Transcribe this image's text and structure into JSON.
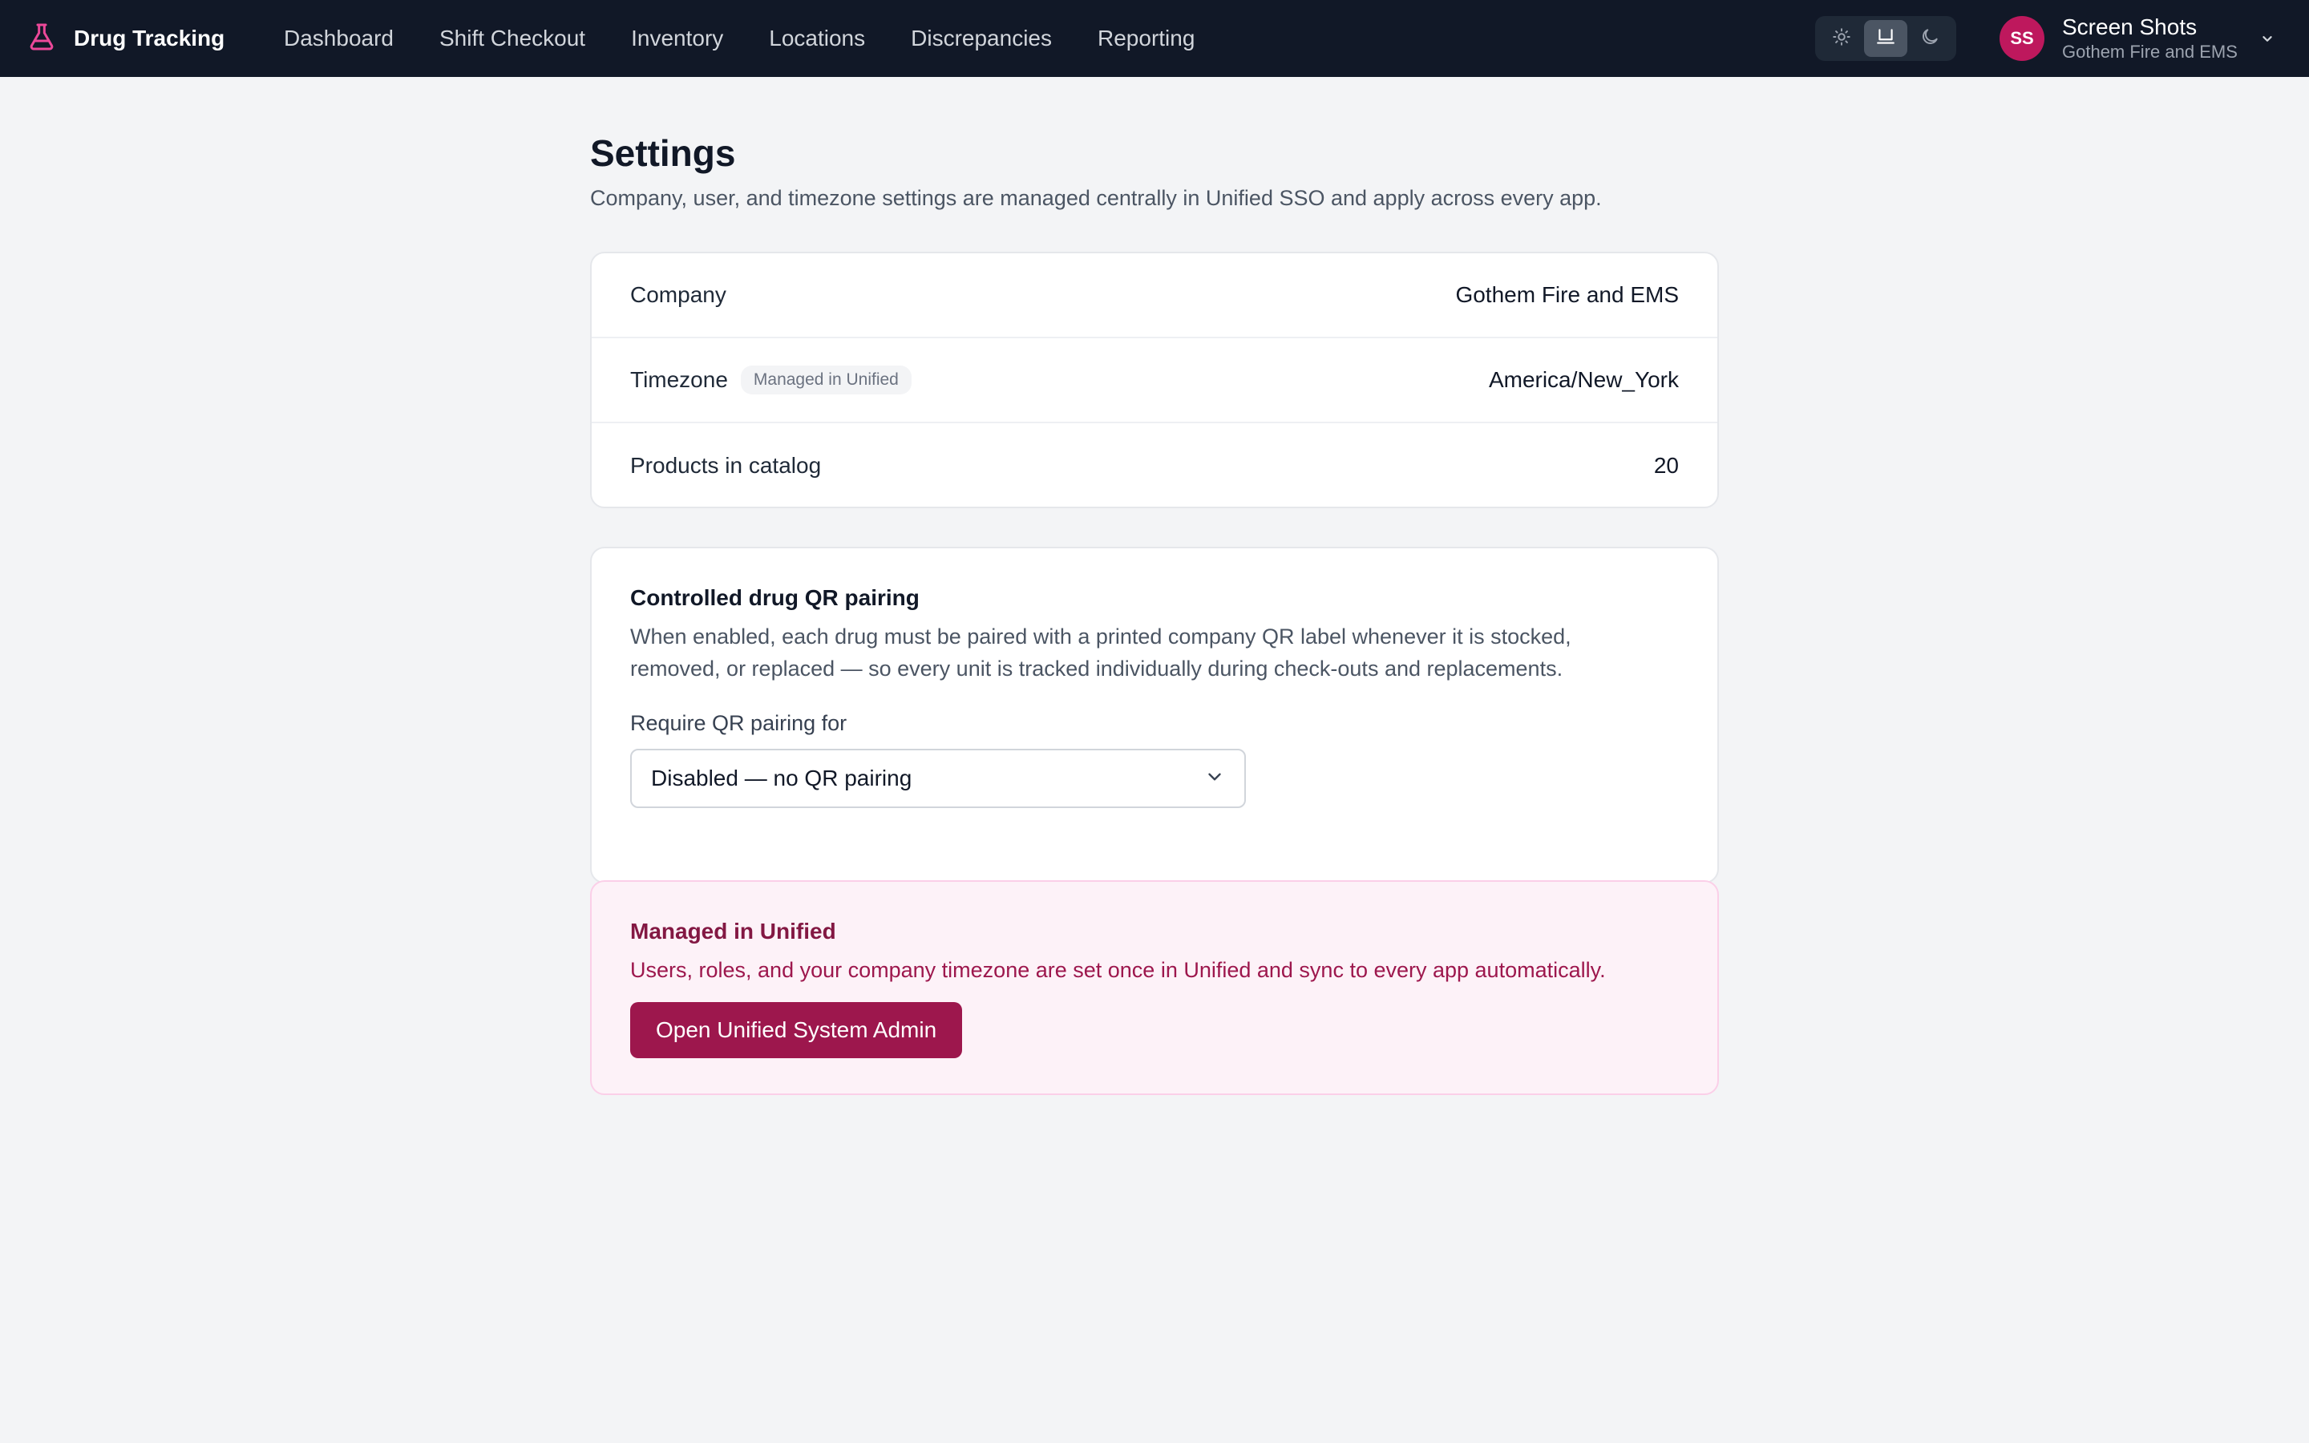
{
  "app": {
    "brand_name": "Drug Tracking",
    "brand_icon": "flask-icon",
    "accent_color": "#ec4899"
  },
  "nav": {
    "items": [
      {
        "label": "Dashboard"
      },
      {
        "label": "Shift Checkout"
      },
      {
        "label": "Inventory"
      },
      {
        "label": "Locations"
      },
      {
        "label": "Discrepancies"
      },
      {
        "label": "Reporting"
      }
    ]
  },
  "theme_toggle": {
    "options": [
      "light",
      "system",
      "dark"
    ],
    "selected": "system"
  },
  "user": {
    "initials": "SS",
    "name": "Screen Shots",
    "org": "Gothem Fire and EMS",
    "avatar_color": "#be185d"
  },
  "page": {
    "title": "Settings",
    "subtitle": "Company, user, and timezone settings are managed centrally in Unified SSO and apply across every app."
  },
  "info": {
    "rows": [
      {
        "label": "Company",
        "value": "Gothem Fire and EMS",
        "tag": ""
      },
      {
        "label": "Timezone",
        "value": "America/New_York",
        "tag": "Managed in Unified"
      },
      {
        "label": "Products in catalog",
        "value": "20",
        "tag": ""
      }
    ]
  },
  "qr": {
    "title": "Controlled drug QR pairing",
    "description": "When enabled, each drug must be paired with a printed company QR label whenever it is stocked, removed, or replaced — so every unit is tracked individually during check-outs and replacements.",
    "select_label": "Require QR pairing for",
    "select_value": "Disabled — no QR pairing"
  },
  "unified": {
    "title": "Managed in Unified",
    "description": "Users, roles, and your company timezone are set once in Unified and sync to every app automatically.",
    "button_label": "Open Unified System Admin"
  }
}
